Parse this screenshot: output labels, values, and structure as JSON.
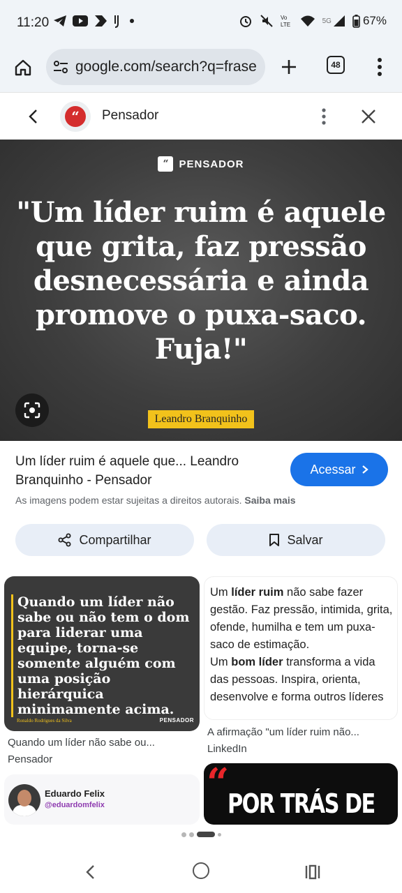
{
  "status_bar": {
    "time": "11:20",
    "battery": "67%",
    "network": "5G"
  },
  "browser": {
    "url": "google.com/search?q=frase",
    "tab_count": "48"
  },
  "panel": {
    "site_name": "Pensador"
  },
  "image": {
    "brand": "PENSADOR",
    "quote": "\"Um líder ruim é aquele que grita, faz pressão desnecessária e ainda promove o puxa-saco. Fuja!\"",
    "author": "Leandro Branquinho"
  },
  "result": {
    "title": "Um líder ruim é aquele que... Leandro Branquinho - Pensador",
    "visit_label": "Acessar",
    "rights_note": "As imagens podem estar sujeitas a direitos autorais.",
    "learn_more": "Saiba mais",
    "share_label": "Compartilhar",
    "save_label": "Salvar"
  },
  "related": [
    {
      "quote": "Quando um líder não sabe ou não tem o dom para liderar uma equipe, torna-se somente alguém com uma posição hierárquica minimamente acima.",
      "image_author": "Ronaldo Rodrigues da Silva",
      "image_brand": "PENSADOR",
      "caption": "Quando um líder não sabe ou...",
      "source": "Pensador"
    },
    {
      "text_part1": "Um ",
      "text_bold1": "líder ruim",
      "text_part2": " não sabe fazer gestão. Faz pressão, intimida, grita, ofende, humilha e tem um puxa-saco de estimação.",
      "text_part3": "Um ",
      "text_bold2": "bom líder",
      "text_part4": " transforma a vida das pessoas. Inspira, orienta, desenvolve e forma outros líderes",
      "caption": "A afirmação \"um líder ruim não...",
      "source": "LinkedIn"
    },
    {
      "name": "Eduardo Felix",
      "handle": "@eduardomfelix"
    },
    {
      "quote_mark": "“",
      "text": "POR TRÁS DE"
    }
  ],
  "colors": {
    "accent": "#1a73e8",
    "author_badge": "#f2c21b",
    "pensador_red": "#d42d2d"
  }
}
